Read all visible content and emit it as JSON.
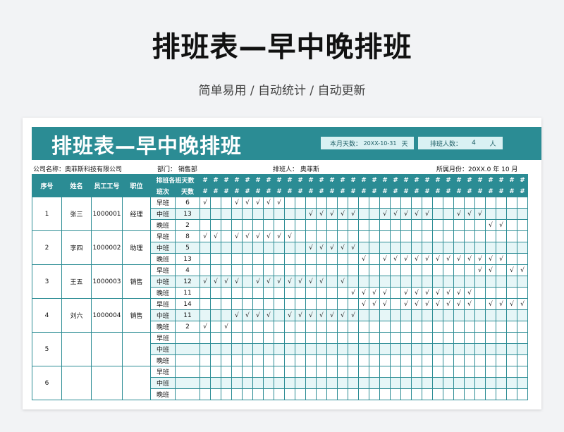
{
  "page": {
    "title": "排班表—早中晚排班",
    "subtitle": "简单易用 / 自动统计 / 自动更新"
  },
  "banner": {
    "title": "排班表—早中晚排班",
    "days_label": "本月天数：",
    "days_value": "20XX-10-31",
    "days_unit": "天",
    "staff_label": "排班人数：",
    "staff_value": "4",
    "staff_unit": "人"
  },
  "meta": {
    "company": "公司名称：奥菲斯科技有限公司",
    "dept": "部门：  销售部",
    "scheduler": "排班人：  奥菲斯",
    "month": "所属月份：20XX.0 年     10   月"
  },
  "header": {
    "no": "序号",
    "name": "姓名",
    "emp_id": "员工工号",
    "position": "职位",
    "summary": "排班各班天数",
    "shift": "班次",
    "days": "天数",
    "day_symbol": "#"
  },
  "shift_names": [
    "早班",
    "中班",
    "晚班"
  ],
  "check": "√",
  "employees": [
    {
      "no": "1",
      "name": "张三",
      "emp_id": "1000001",
      "position": "经理",
      "shifts": [
        {
          "days": "6",
          "marks": [
            0,
            3,
            4,
            5,
            6,
            7
          ]
        },
        {
          "days": "13",
          "marks": [
            10,
            11,
            12,
            13,
            14,
            17,
            18,
            19,
            20,
            21,
            24,
            25,
            26
          ]
        },
        {
          "days": "2",
          "marks": [
            27,
            28
          ]
        }
      ]
    },
    {
      "no": "2",
      "name": "李四",
      "emp_id": "1000002",
      "position": "助理",
      "shifts": [
        {
          "days": "8",
          "marks": [
            0,
            1,
            3,
            4,
            5,
            6,
            7,
            8
          ]
        },
        {
          "days": "5",
          "marks": [
            10,
            11,
            12,
            13,
            14
          ]
        },
        {
          "days": "13",
          "marks": [
            15,
            17,
            18,
            19,
            20,
            21,
            22,
            23,
            24,
            25,
            26,
            27,
            28
          ]
        }
      ]
    },
    {
      "no": "3",
      "name": "王五",
      "emp_id": "1000003",
      "position": "销售",
      "shifts": [
        {
          "days": "4",
          "marks": [
            26,
            27,
            29,
            30
          ]
        },
        {
          "days": "12",
          "marks": [
            0,
            1,
            2,
            3,
            5,
            6,
            7,
            8,
            9,
            10,
            11,
            13
          ]
        },
        {
          "days": "11",
          "marks": [
            14,
            15,
            16,
            17,
            19,
            20,
            21,
            22,
            23,
            24,
            25
          ]
        }
      ]
    },
    {
      "no": "4",
      "name": "刘六",
      "emp_id": "1000004",
      "position": "销售",
      "shifts": [
        {
          "days": "14",
          "marks": [
            15,
            16,
            17,
            19,
            20,
            21,
            22,
            23,
            24,
            25,
            27,
            28,
            29,
            30
          ]
        },
        {
          "days": "11",
          "marks": [
            3,
            4,
            5,
            6,
            8,
            9,
            10,
            11,
            12,
            13,
            14
          ]
        },
        {
          "days": "2",
          "marks": [
            0,
            2
          ]
        }
      ]
    },
    {
      "no": "5",
      "name": "",
      "emp_id": "",
      "position": "",
      "shifts": [
        {
          "days": "",
          "marks": []
        },
        {
          "days": "",
          "marks": []
        },
        {
          "days": "",
          "marks": []
        }
      ]
    },
    {
      "no": "6",
      "name": "",
      "emp_id": "",
      "position": "",
      "shifts": [
        {
          "days": "",
          "marks": []
        },
        {
          "days": "",
          "marks": []
        },
        {
          "days": "",
          "marks": []
        }
      ]
    }
  ],
  "colors": {
    "accent": "#2b8c94",
    "light": "#e6f6f7",
    "info": "#d9f1f3"
  }
}
